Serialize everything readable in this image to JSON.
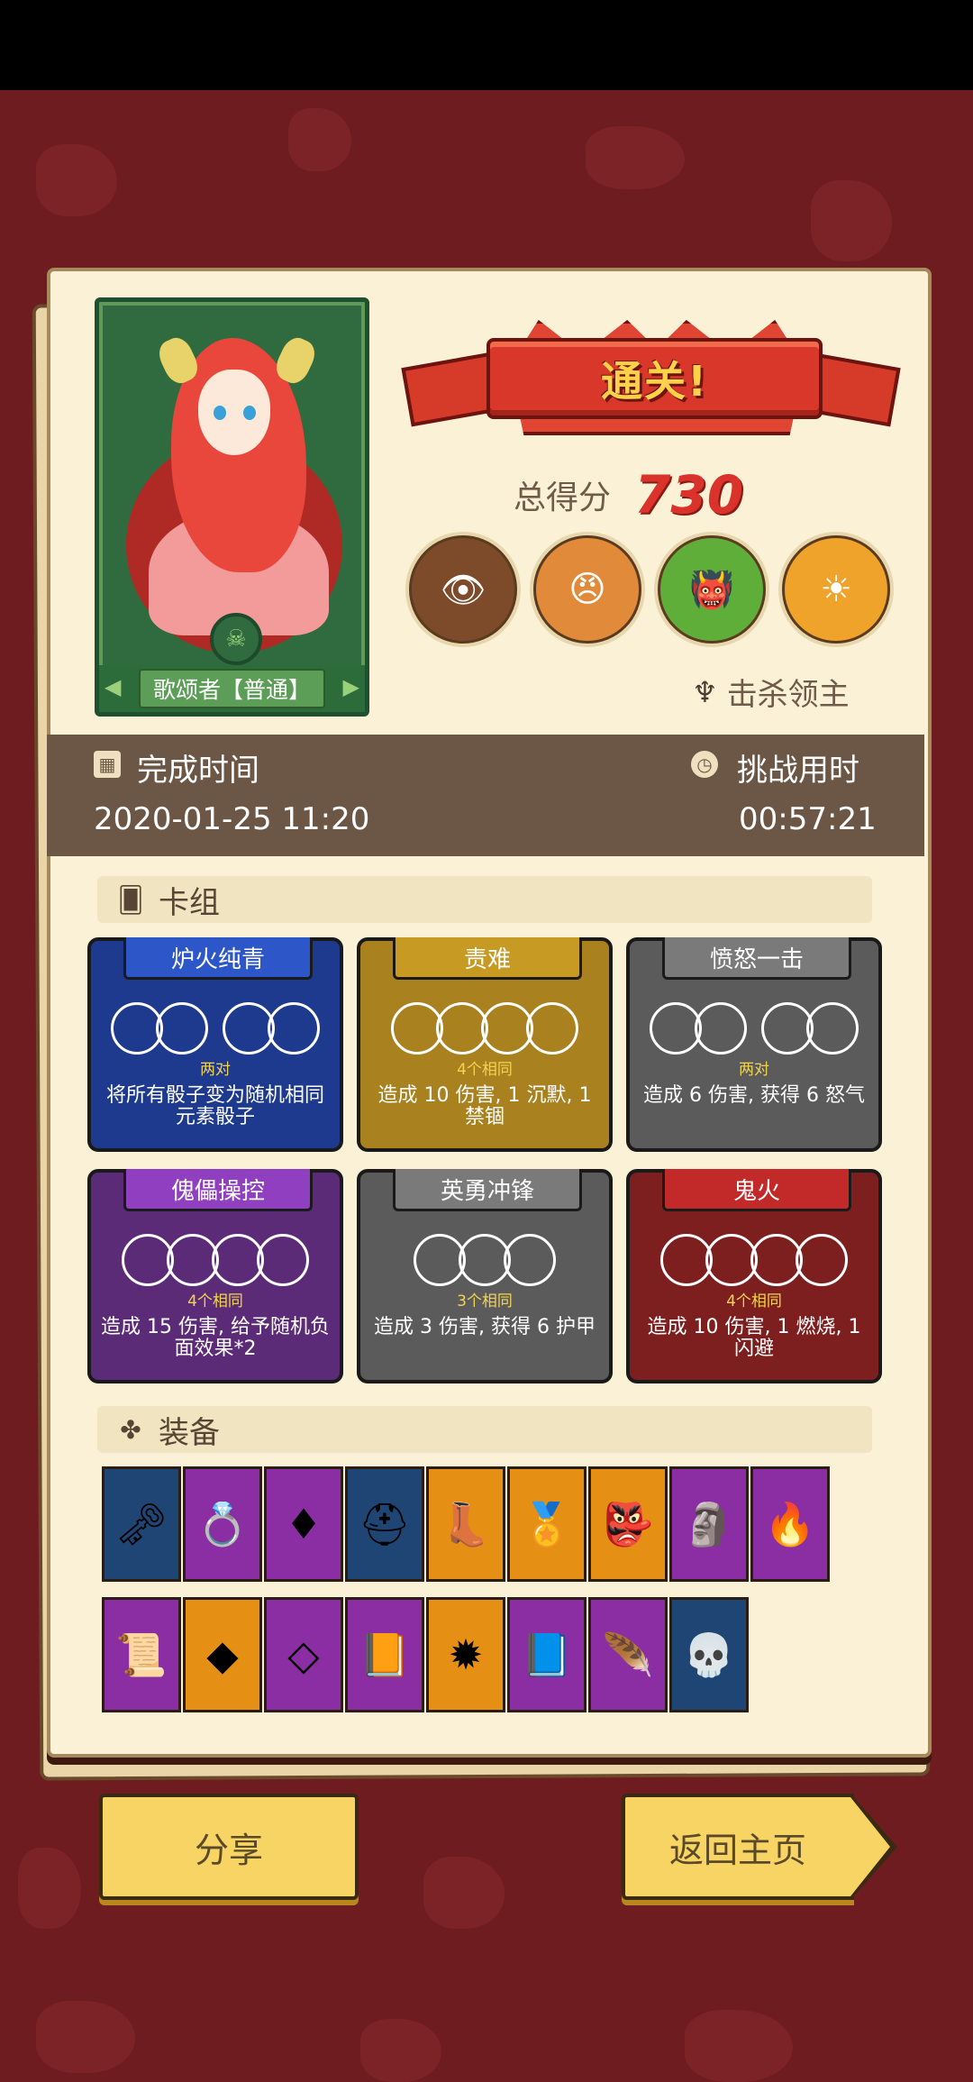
{
  "hero": {
    "name": "歌颂者【普通】"
  },
  "result": {
    "banner": "通关!",
    "score_label": "总得分",
    "score_value": "730",
    "kill_label": "击杀领主"
  },
  "times": {
    "complete_label": "完成时间",
    "complete_value": "2020-01-25 11:20",
    "challenge_label": "挑战用时",
    "challenge_value": "00:57:21"
  },
  "deck": {
    "title": "卡组",
    "cards": [
      {
        "name": "炉火纯青",
        "combo": "两对",
        "desc": "将所有骰子变为随机相同元素骰子",
        "color": "#1e3a8e"
      },
      {
        "name": "责难",
        "combo": "4个相同",
        "desc": "造成 10 伤害, 1 沉默, 1 禁锢",
        "color": "#a9811f"
      },
      {
        "name": "愤怒一击",
        "combo": "两对",
        "desc": "造成 6 伤害, 获得 6 怒气",
        "color": "#5b5b5b"
      },
      {
        "name": "傀儡操控",
        "combo": "4个相同",
        "desc": "造成 15 伤害, 给予随机负面效果*2",
        "color": "#5c2b78"
      },
      {
        "name": "英勇冲锋",
        "combo": "3个相同",
        "desc": "造成 3 伤害, 获得 6 护甲",
        "color": "#5b5b5b"
      },
      {
        "name": "鬼火",
        "combo": "4个相同",
        "desc": "造成 10 伤害, 1 燃烧, 1 闪避",
        "color": "#7e1f1f"
      }
    ]
  },
  "equipment": {
    "title": "装备",
    "row1": [
      "key-icon",
      "red-ring-icon",
      "ruby-gem-icon",
      "golden-helmet-icon",
      "red-boot-icon",
      "gold-medal-icon",
      "demon-mask-icon",
      "totem-icon",
      "fire-stone-icon"
    ],
    "row2": [
      "fire-scroll-icon",
      "crystal-icon",
      "pink-gem-icon",
      "treasure-book-icon",
      "spiked-orb-icon",
      "skull-tome-icon",
      "feather-icon",
      "skull-icon"
    ]
  },
  "buttons": {
    "share": "分享",
    "home": "返回主页"
  }
}
